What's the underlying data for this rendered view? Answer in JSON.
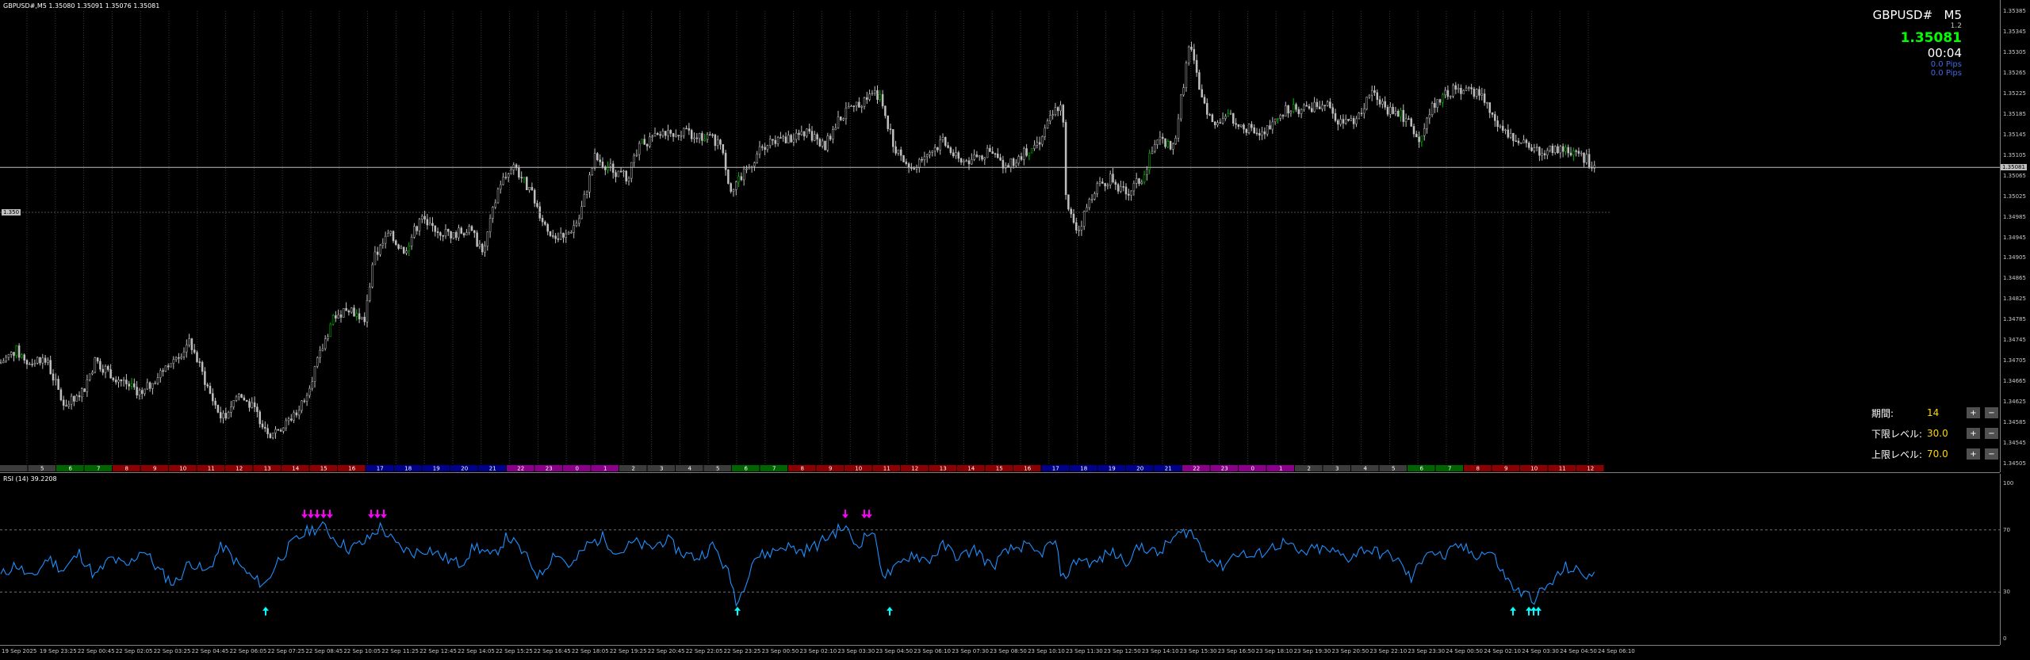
{
  "window": {
    "title": "GBPUSD#,M5  1.35080 1.35091 1.35076 1.35081"
  },
  "info_box": {
    "symbol": "GBPUSD#",
    "timeframe": "M5",
    "spread": "1.2",
    "price": "1.35081",
    "timer": "00:04",
    "pips1": "0.0 Pips",
    "pips2": "0.0 Pips"
  },
  "price_tags": {
    "left_tag": "1.350",
    "current": "1.35081"
  },
  "rsi": {
    "title": "RSI (14) 39.2208",
    "period_label": "期間:",
    "period_value": "14",
    "lower_label": "下限レベル:",
    "lower_value": "30.0",
    "upper_label": "上限レベル:",
    "upper_value": "70.0",
    "plus_btn": "+",
    "minus_btn": "−"
  },
  "colors": {
    "bg": "#000000",
    "candle": "#c0c0c0",
    "bull_accent": "#00c000",
    "rsi_line": "#1e90ff",
    "up_arrow": "#00ffff",
    "down_arrow": "#ff00ff",
    "current_line": "#c0c0c0"
  },
  "chart_data": [
    {
      "type": "candlestick",
      "symbol": "GBPUSD#",
      "timeframe": "M5",
      "ylim": [
        1.34505,
        1.35385
      ],
      "y_ticks": [
        "1.35385",
        "1.35345",
        "1.35305",
        "1.35265",
        "1.35225",
        "1.35185",
        "1.35145",
        "1.35105",
        "1.35065",
        "1.35025",
        "1.34985",
        "1.34945",
        "1.34905",
        "1.34865",
        "1.34825",
        "1.34785",
        "1.34745",
        "1.34705",
        "1.34665",
        "1.34625",
        "1.34585",
        "1.34545",
        "1.34505"
      ],
      "x_ticks": [
        "19 Sep 2025",
        "19 Sep 23:25",
        "22 Sep 00:45",
        "22 Sep 02:05",
        "22 Sep 03:25",
        "22 Sep 04:45",
        "22 Sep 06:05",
        "22 Sep 07:25",
        "22 Sep 08:45",
        "22 Sep 10:05",
        "22 Sep 11:25",
        "22 Sep 12:45",
        "22 Sep 14:05",
        "22 Sep 15:25",
        "22 Sep 16:45",
        "22 Sep 18:05",
        "22 Sep 19:25",
        "22 Sep 20:45",
        "22 Sep 22:05",
        "22 Sep 23:25",
        "23 Sep 00:50",
        "23 Sep 02:10",
        "23 Sep 03:30",
        "23 Sep 04:50",
        "23 Sep 06:10",
        "23 Sep 07:30",
        "23 Sep 08:50",
        "23 Sep 10:10",
        "23 Sep 11:30",
        "23 Sep 12:50",
        "23 Sep 14:10",
        "23 Sep 15:30",
        "23 Sep 16:50",
        "23 Sep 18:10",
        "23 Sep 19:30",
        "23 Sep 20:50",
        "23 Sep 22:10",
        "23 Sep 23:30",
        "24 Sep 00:50",
        "24 Sep 02:10",
        "24 Sep 03:30",
        "24 Sep 04:50",
        "24 Sep 06:10"
      ],
      "close_path": [
        [
          0,
          1.347
        ],
        [
          20,
          1.34725
        ],
        [
          35,
          1.347
        ],
        [
          50,
          1.3471
        ],
        [
          60,
          1.347
        ],
        [
          80,
          1.3462
        ],
        [
          100,
          1.3463
        ],
        [
          120,
          1.34705
        ],
        [
          140,
          1.3468
        ],
        [
          160,
          1.3466
        ],
        [
          180,
          1.3464
        ],
        [
          200,
          1.3468
        ],
        [
          220,
          1.3471
        ],
        [
          240,
          1.3474
        ],
        [
          250,
          1.347
        ],
        [
          265,
          1.3464
        ],
        [
          280,
          1.3459
        ],
        [
          300,
          1.3464
        ],
        [
          320,
          1.3461
        ],
        [
          340,
          1.34565
        ],
        [
          360,
          1.3458
        ],
        [
          380,
          1.3462
        ],
        [
          400,
          1.347
        ],
        [
          420,
          1.3479
        ],
        [
          440,
          1.3481
        ],
        [
          460,
          1.3478
        ],
        [
          470,
          1.349
        ],
        [
          490,
          1.3495
        ],
        [
          510,
          1.3492
        ],
        [
          530,
          1.3498
        ],
        [
          550,
          1.3496
        ],
        [
          570,
          1.3495
        ],
        [
          590,
          1.3496
        ],
        [
          610,
          1.3492
        ],
        [
          630,
          1.3505
        ],
        [
          650,
          1.3508
        ],
        [
          670,
          1.3503
        ],
        [
          690,
          1.3496
        ],
        [
          710,
          1.3494
        ],
        [
          730,
          1.3498
        ],
        [
          750,
          1.351
        ],
        [
          770,
          1.3508
        ],
        [
          790,
          1.3506
        ],
        [
          810,
          1.3513
        ],
        [
          830,
          1.3514
        ],
        [
          850,
          1.3515
        ],
        [
          870,
          1.35145
        ],
        [
          890,
          1.3514
        ],
        [
          910,
          1.3513
        ],
        [
          920,
          1.3504
        ],
        [
          940,
          1.3507
        ],
        [
          960,
          1.3512
        ],
        [
          980,
          1.3513
        ],
        [
          1000,
          1.3514
        ],
        [
          1020,
          1.3515
        ],
        [
          1040,
          1.3512
        ],
        [
          1060,
          1.3518
        ],
        [
          1080,
          1.352
        ],
        [
          1100,
          1.3523
        ],
        [
          1110,
          1.3522
        ],
        [
          1130,
          1.3511
        ],
        [
          1150,
          1.3508
        ],
        [
          1170,
          1.3511
        ],
        [
          1190,
          1.3513
        ],
        [
          1210,
          1.3509
        ],
        [
          1230,
          1.351
        ],
        [
          1250,
          1.3511
        ],
        [
          1270,
          1.3508
        ],
        [
          1290,
          1.3511
        ],
        [
          1310,
          1.3513
        ],
        [
          1330,
          1.3519
        ],
        [
          1340,
          1.3521
        ],
        [
          1345,
          1.35
        ],
        [
          1360,
          1.3496
        ],
        [
          1380,
          1.3504
        ],
        [
          1400,
          1.3506
        ],
        [
          1420,
          1.3503
        ],
        [
          1440,
          1.3506
        ],
        [
          1460,
          1.3514
        ],
        [
          1480,
          1.3512
        ],
        [
          1500,
          1.3532
        ],
        [
          1510,
          1.3525
        ],
        [
          1530,
          1.3516
        ],
        [
          1550,
          1.3518
        ],
        [
          1570,
          1.3516
        ],
        [
          1590,
          1.3514
        ],
        [
          1610,
          1.3518
        ],
        [
          1630,
          1.352
        ],
        [
          1650,
          1.3519
        ],
        [
          1670,
          1.3521
        ],
        [
          1690,
          1.3517
        ],
        [
          1710,
          1.3517
        ],
        [
          1730,
          1.3523
        ],
        [
          1750,
          1.3519
        ],
        [
          1770,
          1.3518
        ],
        [
          1790,
          1.3514
        ],
        [
          1810,
          1.3521
        ],
        [
          1830,
          1.3523
        ],
        [
          1850,
          1.3523
        ],
        [
          1870,
          1.3522
        ],
        [
          1890,
          1.3516
        ],
        [
          1910,
          1.3513
        ],
        [
          1930,
          1.3512
        ],
        [
          1950,
          1.3511
        ],
        [
          1970,
          1.3512
        ],
        [
          1990,
          1.3511
        ],
        [
          2013,
          1.35081
        ]
      ]
    },
    {
      "type": "line",
      "name": "RSI (14) 39.2208",
      "ylim": [
        0,
        100
      ],
      "y_ticks": [
        "100",
        "70",
        "30",
        "0"
      ],
      "levels": [
        70,
        30
      ],
      "values_path": [
        [
          0,
          40
        ],
        [
          20,
          48
        ],
        [
          40,
          38
        ],
        [
          60,
          52
        ],
        [
          80,
          44
        ],
        [
          100,
          55
        ],
        [
          120,
          40
        ],
        [
          140,
          52
        ],
        [
          160,
          46
        ],
        [
          180,
          58
        ],
        [
          200,
          44
        ],
        [
          220,
          35
        ],
        [
          240,
          50
        ],
        [
          260,
          42
        ],
        [
          280,
          60
        ],
        [
          300,
          48
        ],
        [
          320,
          38
        ],
        [
          335,
          35
        ],
        [
          350,
          50
        ],
        [
          370,
          62
        ],
        [
          390,
          70
        ],
        [
          410,
          72
        ],
        [
          420,
          65
        ],
        [
          440,
          58
        ],
        [
          460,
          62
        ],
        [
          480,
          72
        ],
        [
          500,
          60
        ],
        [
          520,
          55
        ],
        [
          540,
          58
        ],
        [
          560,
          52
        ],
        [
          580,
          48
        ],
        [
          600,
          60
        ],
        [
          620,
          52
        ],
        [
          640,
          66
        ],
        [
          660,
          55
        ],
        [
          680,
          40
        ],
        [
          700,
          56
        ],
        [
          720,
          46
        ],
        [
          740,
          60
        ],
        [
          760,
          65
        ],
        [
          780,
          55
        ],
        [
          800,
          62
        ],
        [
          820,
          58
        ],
        [
          840,
          64
        ],
        [
          860,
          55
        ],
        [
          880,
          52
        ],
        [
          900,
          60
        ],
        [
          920,
          40
        ],
        [
          930,
          22
        ],
        [
          950,
          52
        ],
        [
          970,
          55
        ],
        [
          990,
          60
        ],
        [
          1010,
          56
        ],
        [
          1030,
          60
        ],
        [
          1050,
          68
        ],
        [
          1065,
          72
        ],
        [
          1080,
          60
        ],
        [
          1100,
          70
        ],
        [
          1115,
          40
        ],
        [
          1130,
          45
        ],
        [
          1150,
          55
        ],
        [
          1170,
          50
        ],
        [
          1190,
          60
        ],
        [
          1210,
          52
        ],
        [
          1230,
          58
        ],
        [
          1250,
          46
        ],
        [
          1270,
          56
        ],
        [
          1290,
          60
        ],
        [
          1310,
          54
        ],
        [
          1330,
          63
        ],
        [
          1340,
          38
        ],
        [
          1360,
          52
        ],
        [
          1380,
          48
        ],
        [
          1400,
          56
        ],
        [
          1420,
          50
        ],
        [
          1440,
          60
        ],
        [
          1460,
          54
        ],
        [
          1480,
          65
        ],
        [
          1500,
          70
        ],
        [
          1520,
          55
        ],
        [
          1540,
          46
        ],
        [
          1560,
          56
        ],
        [
          1580,
          52
        ],
        [
          1600,
          58
        ],
        [
          1620,
          62
        ],
        [
          1640,
          54
        ],
        [
          1660,
          58
        ],
        [
          1680,
          56
        ],
        [
          1700,
          52
        ],
        [
          1720,
          58
        ],
        [
          1740,
          55
        ],
        [
          1760,
          52
        ],
        [
          1780,
          38
        ],
        [
          1800,
          58
        ],
        [
          1820,
          52
        ],
        [
          1840,
          60
        ],
        [
          1860,
          54
        ],
        [
          1880,
          56
        ],
        [
          1900,
          38
        ],
        [
          1915,
          30
        ],
        [
          1935,
          26
        ],
        [
          1955,
          35
        ],
        [
          1975,
          46
        ],
        [
          1995,
          42
        ],
        [
          2013,
          39
        ]
      ],
      "buy_arrows_x": [
        335,
        930,
        1122,
        1908,
        1928,
        1934,
        1940
      ],
      "sell_arrows_x": [
        384,
        392,
        400,
        408,
        416,
        468,
        476,
        484,
        1066,
        1090,
        1096
      ]
    }
  ],
  "time_bands": [
    {
      "label": "",
      "color": "#3c3c3c"
    },
    {
      "label": "5",
      "color": "#3c3c3c"
    },
    {
      "label": "6",
      "color": "#006400"
    },
    {
      "label": "7",
      "color": "#006400"
    },
    {
      "label": "8",
      "color": "#8b0000"
    },
    {
      "label": "9",
      "color": "#8b0000"
    },
    {
      "label": "10",
      "color": "#8b0000"
    },
    {
      "label": "11",
      "color": "#8b0000"
    },
    {
      "label": "12",
      "color": "#8b0000"
    },
    {
      "label": "13",
      "color": "#8b0000"
    },
    {
      "label": "14",
      "color": "#8b0000"
    },
    {
      "label": "15",
      "color": "#8b0000"
    },
    {
      "label": "16",
      "color": "#8b0000"
    },
    {
      "label": "17",
      "color": "#00008b"
    },
    {
      "label": "18",
      "color": "#00008b"
    },
    {
      "label": "19",
      "color": "#00008b"
    },
    {
      "label": "20",
      "color": "#00008b"
    },
    {
      "label": "21",
      "color": "#00008b"
    },
    {
      "label": "22",
      "color": "#8b008b"
    },
    {
      "label": "23",
      "color": "#8b008b"
    },
    {
      "label": "0",
      "color": "#8b008b"
    },
    {
      "label": "1",
      "color": "#8b008b"
    },
    {
      "label": "2",
      "color": "#3c3c3c"
    },
    {
      "label": "3",
      "color": "#3c3c3c"
    },
    {
      "label": "4",
      "color": "#3c3c3c"
    },
    {
      "label": "5",
      "color": "#3c3c3c"
    },
    {
      "label": "6",
      "color": "#006400"
    },
    {
      "label": "7",
      "color": "#006400"
    },
    {
      "label": "8",
      "color": "#8b0000"
    },
    {
      "label": "9",
      "color": "#8b0000"
    },
    {
      "label": "10",
      "color": "#8b0000"
    },
    {
      "label": "11",
      "color": "#8b0000"
    },
    {
      "label": "12",
      "color": "#8b0000"
    },
    {
      "label": "13",
      "color": "#8b0000"
    },
    {
      "label": "14",
      "color": "#8b0000"
    },
    {
      "label": "15",
      "color": "#8b0000"
    },
    {
      "label": "16",
      "color": "#8b0000"
    },
    {
      "label": "17",
      "color": "#00008b"
    },
    {
      "label": "18",
      "color": "#00008b"
    },
    {
      "label": "19",
      "color": "#00008b"
    },
    {
      "label": "20",
      "color": "#00008b"
    },
    {
      "label": "21",
      "color": "#00008b"
    },
    {
      "label": "22",
      "color": "#8b008b"
    },
    {
      "label": "23",
      "color": "#8b008b"
    },
    {
      "label": "0",
      "color": "#8b008b"
    },
    {
      "label": "1",
      "color": "#8b008b"
    },
    {
      "label": "2",
      "color": "#3c3c3c"
    },
    {
      "label": "3",
      "color": "#3c3c3c"
    },
    {
      "label": "4",
      "color": "#3c3c3c"
    },
    {
      "label": "5",
      "color": "#3c3c3c"
    },
    {
      "label": "6",
      "color": "#006400"
    },
    {
      "label": "7",
      "color": "#006400"
    },
    {
      "label": "8",
      "color": "#8b0000"
    },
    {
      "label": "9",
      "color": "#8b0000"
    },
    {
      "label": "10",
      "color": "#8b0000"
    },
    {
      "label": "11",
      "color": "#8b0000"
    },
    {
      "label": "12",
      "color": "#8b0000"
    }
  ]
}
